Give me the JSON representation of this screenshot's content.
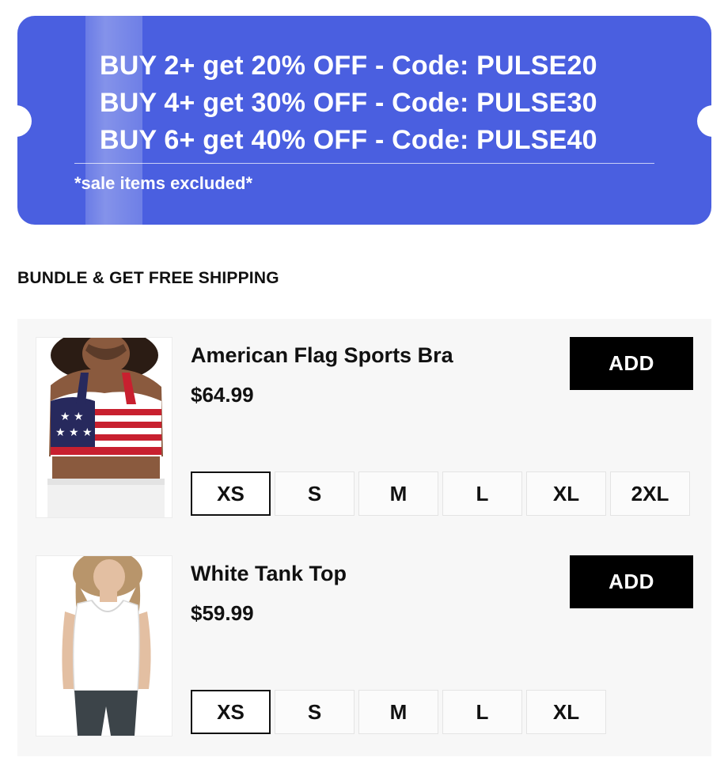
{
  "banner": {
    "lines": [
      "BUY 2+ get 20% OFF - Code: PULSE20",
      "BUY 4+ get 30% OFF - Code: PULSE30",
      "BUY 6+ get 40% OFF - Code: PULSE40"
    ],
    "note": "*sale items excluded*",
    "color": "#4a5fe0"
  },
  "section_title": "BUNDLE & GET FREE SHIPPING",
  "products": [
    {
      "name": "American Flag Sports Bra",
      "price": "$64.99",
      "add_label": "ADD",
      "sizes": [
        "XS",
        "S",
        "M",
        "L",
        "XL",
        "2XL"
      ],
      "selected_size": "XS"
    },
    {
      "name": "White Tank Top",
      "price": "$59.99",
      "add_label": "ADD",
      "sizes": [
        "XS",
        "S",
        "M",
        "L",
        "XL"
      ],
      "selected_size": "XS"
    }
  ]
}
